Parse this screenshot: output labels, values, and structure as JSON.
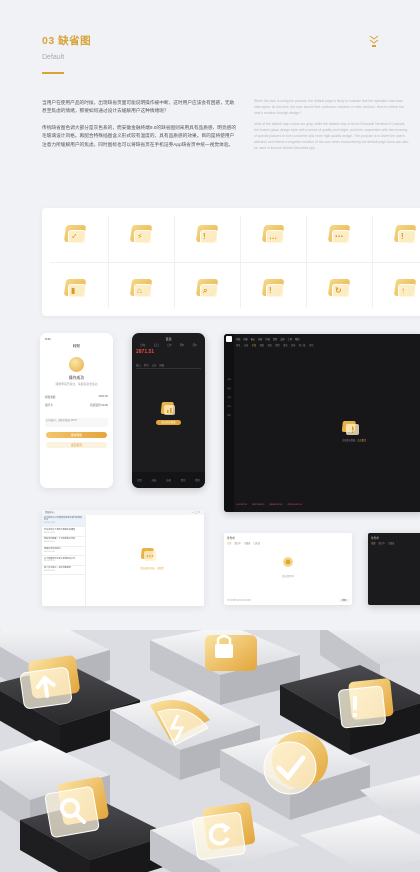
{
  "header": {
    "title": "03 缺省图",
    "subtitle": "Default"
  },
  "intro": {
    "cn_p1": "当用户在使用产品的时候，出现缺省页面可能说明操作被中断。这时用户应该会有困惑，无助甚至焦虑的情绪，那要如何通过设计去缓解用户这种情绪呢？",
    "cn_p2": "传统缺省图色调大部分是灰色系的，而安徽金融终端9.0的缺省图则采用具有品质感、明亮感的毛玻璃设计风格。再配合特殊插图含义形式较有温度的、具有品质感的效果。目的是将使用户注意力所缓解用户的焦虑，同时图标也可以将缺省页在手机证券App缺省页中统一视觉体验。",
    "en_p1": "When the user is using the product, the default page is likely to indicate that the operation has been interrupted. At this time, the user should feel confusion, helpless or even anxious. How to relieve the user's emotion through design?",
    "en_p2": "Most of the default map colors are gray, while the default map of Anxin Financial Terminal 9.0 adopts the frosted glass design style with a sense of quality and bright, and then cooperates with the meaning of special pictures to form a warmer and more high-quality design. The purpose is to divert the user's attention and relieve a negative emotion of the user when encountering the default page icons can also be used in finance Mobile Securities App."
  },
  "icons": [
    {
      "name": "check-icon",
      "glyph": "✓"
    },
    {
      "name": "broken-link-icon",
      "glyph": "⚡"
    },
    {
      "name": "warning-icon",
      "glyph": "!"
    },
    {
      "name": "message-icon",
      "glyph": "…"
    },
    {
      "name": "loading-icon",
      "glyph": "⋯"
    },
    {
      "name": "info-icon",
      "glyph": "!"
    },
    {
      "name": "chart-icon",
      "glyph": "▮"
    },
    {
      "name": "lock-icon",
      "glyph": "⌂"
    },
    {
      "name": "search-icon",
      "glyph": "⌕"
    },
    {
      "name": "alert-icon",
      "glyph": "!"
    },
    {
      "name": "refresh-icon",
      "glyph": "↻"
    },
    {
      "name": "upload-icon",
      "glyph": "↑"
    }
  ],
  "phone_light": {
    "status": "9:41",
    "nav_title": "转账",
    "result_title": "操作成功",
    "result_desc": "转账申请已提交，请留意资金变动",
    "rows": [
      {
        "label": "转账金额",
        "value": "5000.00"
      },
      {
        "label": "银行卡",
        "value": "招商银行(6228)"
      }
    ],
    "note": "如有疑问，请联系客服 95517",
    "primary_btn": "继续转账",
    "secondary_btn": "返回首页"
  },
  "phone_dark": {
    "top": "自选",
    "tabs": [
      "分时",
      "五日",
      "日K",
      "周K",
      "月K"
    ],
    "price": "2871.51",
    "subtabs": [
      "盘口",
      "资讯",
      "公告",
      "研报"
    ],
    "empty_btn": "暂无相关数据",
    "bottom": [
      "行情",
      "自选",
      "交易",
      "资讯",
      "我的"
    ]
  },
  "desktop_dark": {
    "menu": [
      "系统",
      "功能",
      "报价",
      "分析",
      "扩展",
      "资讯",
      "交易",
      "工具",
      "帮助"
    ],
    "tabs": [
      "首页",
      "自选",
      "沪深",
      "港股",
      "美股",
      "期货",
      "基金",
      "债券",
      "新三板",
      "资讯"
    ],
    "side": [
      "行情",
      "自选",
      "交易",
      "资讯",
      "我的"
    ],
    "empty_text": "当前暂无数据，",
    "empty_link": "点击重试",
    "foot": [
      "上证 2871.51",
      "深证 10298.35",
      "创业板 2087.44",
      "沪深300 3952.18"
    ]
  },
  "win_a": {
    "head": "消息中心",
    "items": [
      {
        "title": "关于发布2021年度安信证券交易日安排的公告",
        "date": "2021-12-28"
      },
      {
        "title": "安信证券关于系统升级维护的通知",
        "date": "2021-12-25"
      },
      {
        "title": "新股申购提醒：今日有新股可申购",
        "date": "2021-12-21"
      },
      {
        "title": "两融业务风险提示",
        "date": "2021-12-18"
      },
      {
        "title": "关于调整部分证券交易佣金的公告",
        "date": "2021-12-15"
      },
      {
        "title": "账户安全提示：请勿泄露密码",
        "date": "2021-12-12"
      }
    ],
    "ctrls": "— ▢ ✕",
    "empty_text": "暂无相关内容，",
    "empty_link": "去看看"
  },
  "win_b": {
    "head": "条件单",
    "tabs": [
      "全部",
      "监控中",
      "已触发",
      "已失效"
    ],
    "empty_text": "暂无条件单",
    "foot_note": "条件单服务由安信证券提供",
    "foot_btn": "新建"
  },
  "win_c": {
    "head": "条件单",
    "tabs": [
      "全部",
      "监控中",
      "已触发"
    ]
  },
  "colors": {
    "accent": "#d8a437",
    "gold_light": "#f6d88a",
    "gold_dark": "#e3a53c",
    "bg": "#f1f2f6"
  }
}
